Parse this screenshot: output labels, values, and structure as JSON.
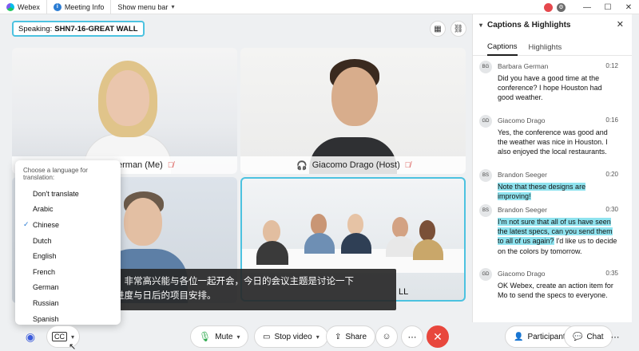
{
  "titlebar": {
    "app_name": "Webex",
    "meeting_info": "Meeting Info",
    "show_menu_bar": "Show menu bar"
  },
  "speaking": {
    "label": "Speaking:",
    "name": "SHN7-16-GREAT WALL"
  },
  "tiles": [
    {
      "name": "erman (Me)"
    },
    {
      "name": "Giacomo Drago (Host)"
    },
    {
      "name": ""
    },
    {
      "name": "LL"
    }
  ],
  "language_menu": {
    "title": "Choose a language for translation:",
    "selected": "Chinese",
    "options": [
      "Don't translate",
      "Arabic",
      "Chinese",
      "Dutch",
      "English",
      "French",
      "German",
      "Russian",
      "Spanish"
    ]
  },
  "caption_text": {
    "line1": "！非常高兴能与各位一起开会，今日的会议主题是讨论一下",
    "line2": "进度与日后的项目安排。"
  },
  "panel": {
    "title": "Captions & Highlights",
    "tabs": [
      "Captions",
      "Highlights"
    ],
    "messages": [
      {
        "initials": "BG",
        "who": "Barbara German",
        "time": "0:12",
        "text": "Did you have a good time at the conference? I hope Houston had good weather.",
        "highlight": false
      },
      {
        "initials": "GD",
        "who": "Giacomo Drago",
        "time": "0:16",
        "text": "Yes, the conference was good and the weather was nice in Houston. I also enjoyed the local restaurants.",
        "highlight": false
      },
      {
        "initials": "BS",
        "who": "Brandon Seeger",
        "time": "0:20",
        "text": "Note that these designs are improving!",
        "highlight": true
      },
      {
        "initials": "BS",
        "who": "Brandon Seeger",
        "time": "0:30",
        "text_hl": "I'm not sure that all of us have seen the latest specs, can you send them to all of us again?",
        "text_rest": " I'd like us to decide on the colors by tomorrow.",
        "highlight": true
      },
      {
        "initials": "GD",
        "who": "Giacomo Drago",
        "time": "0:35",
        "text": "OK Webex, create an action item for Mo to send the specs to everyone.",
        "highlight": false
      }
    ]
  },
  "controls": {
    "mute": "Mute",
    "stop_video": "Stop video",
    "share": "Share",
    "participants": "Participants",
    "chat": "Chat"
  }
}
